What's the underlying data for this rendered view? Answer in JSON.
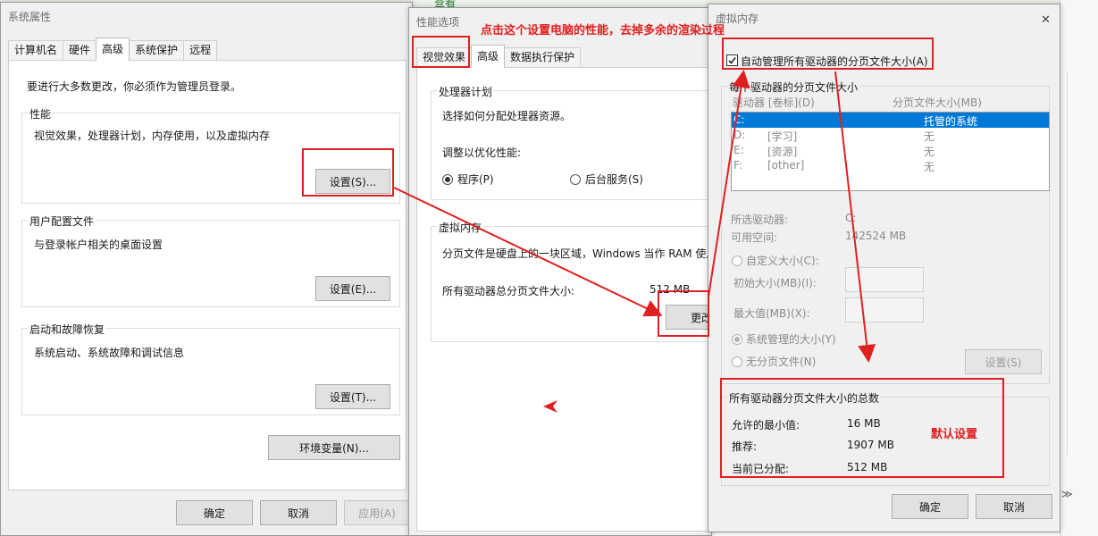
{
  "background_windows": {
    "top_link_text": "查看",
    "right_scroll_glyph": "≫"
  },
  "system_properties": {
    "title": "系统属性",
    "tabs": [
      "计算机名",
      "硬件",
      "高级",
      "系统保护",
      "远程"
    ],
    "admin_note": "要进行大多数更改，你必须作为管理员登录。",
    "performance": {
      "label": "性能",
      "desc": "视觉效果，处理器计划，内存使用，以及虚拟内存",
      "button": "设置(S)..."
    },
    "user_profiles": {
      "label": "用户配置文件",
      "desc": "与登录帐户相关的桌面设置",
      "button": "设置(E)..."
    },
    "startup_recovery": {
      "label": "启动和故障恢复",
      "desc": "系统启动、系统故障和调试信息",
      "button": "设置(T)..."
    },
    "env_button": "环境变量(N)...",
    "ok": "确定",
    "cancel": "取消",
    "apply": "应用(A)"
  },
  "performance_options": {
    "title": "性能选项",
    "tabs": [
      "视觉效果",
      "高级",
      "数据执行保护"
    ],
    "processor": {
      "label": "处理器计划",
      "desc": "选择如何分配处理器资源。",
      "adjust_label": "调整以优化性能:",
      "programs": "程序(P)",
      "background": "后台服务(S)"
    },
    "virtual_memory": {
      "label": "虚拟内存",
      "desc": "分页文件是硬盘上的一块区域，Windows 当作 RAM 使用。",
      "total_label": "所有驱动器总分页文件大小:",
      "total_value": "512 MB",
      "change_button": "更改"
    }
  },
  "virtual_memory": {
    "title": "虚拟内存",
    "close_glyph": "✕",
    "auto_manage": "自动管理所有驱动器的分页文件大小(A)",
    "auto_manage_checked": true,
    "per_drive_label": "每个驱动器的分页文件大小",
    "col_drive": "驱动器 [卷标](D)",
    "col_size": "分页文件大小(MB)",
    "drives": [
      {
        "drive": "C:",
        "label": "",
        "size": "托管的系统"
      },
      {
        "drive": "D:",
        "label": "[学习]",
        "size": "无"
      },
      {
        "drive": "E:",
        "label": "[资源]",
        "size": "无"
      },
      {
        "drive": "F:",
        "label": "[other]",
        "size": "无"
      }
    ],
    "selected_drive_label": "所选驱动器:",
    "selected_drive_value": "C:",
    "free_space_label": "可用空间:",
    "free_space_value": "142524 MB",
    "custom_size": "自定义大小(C):",
    "initial_size": "初始大小(MB)(I):",
    "max_size": "最大值(MB)(X):",
    "system_managed": "系统管理的大小(Y)",
    "no_paging": "无分页文件(N)",
    "set_button": "设置(S)",
    "totals": {
      "label": "所有驱动器分页文件大小的总数",
      "min_label": "允许的最小值:",
      "min_value": "16 MB",
      "recommended_label": "推荐:",
      "recommended_value": "1907 MB",
      "allocated_label": "当前已分配:",
      "allocated_value": "512 MB"
    },
    "ok": "确定",
    "cancel": "取消"
  },
  "annotations": {
    "top_note": "点击这个设置电脑的性能，去掉多余的渲染过程",
    "default_note": "默认设置",
    "color": "#e02020"
  }
}
